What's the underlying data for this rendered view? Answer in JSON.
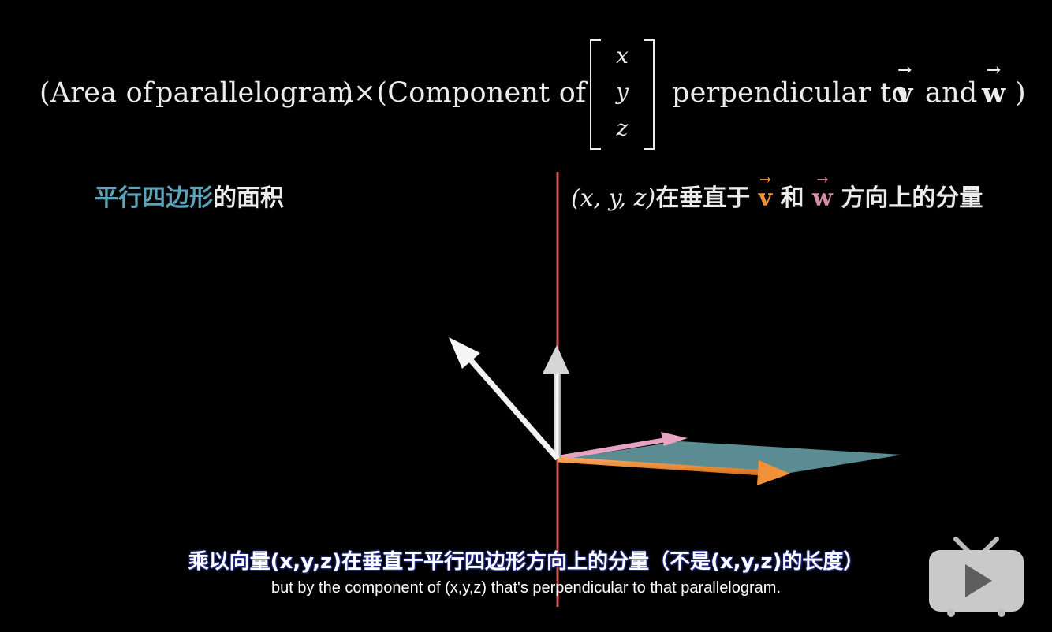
{
  "formula": {
    "open_paren": "(Area of",
    "parallelogram": "parallelogram",
    "times_component": ")×(Component of",
    "matrix": [
      "x",
      "y",
      "z"
    ],
    "perpendicular_to": "perpendicular to",
    "v": "v",
    "and": "and",
    "w": "w",
    "close_paren": ")"
  },
  "left_caption": {
    "highlight": "平行四边形",
    "rest": "的面积"
  },
  "right_caption": {
    "xyz": "(x, y, z)",
    "zai": "在垂直于",
    "v": "v",
    "he": "和",
    "w": "w",
    "rest": "方向上的分量"
  },
  "subtitles": {
    "chinese": "乘以向量(x,y,z)在垂直于平行四边形方向上的分量（不是(x,y,z)的长度）",
    "english": "but by the component of (x,y,z) that's perpendicular to that parallelogram."
  },
  "colors": {
    "teal": "#5fa3ba",
    "orange": "#f0913a",
    "pink": "#d98ba7",
    "red_line": "#d9534f"
  },
  "icons": {
    "play": "play-button-tv-icon"
  }
}
